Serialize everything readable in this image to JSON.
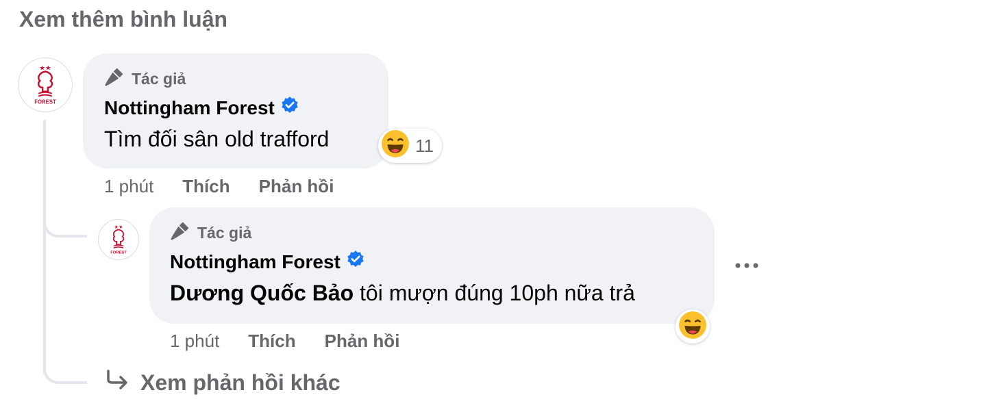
{
  "header": {
    "more_comments": "Xem thêm bình luận"
  },
  "comments": [
    {
      "author_badge": "Tác giả",
      "name": "Nottingham Forest",
      "verified": true,
      "text": "Tìm đối sân old trafford",
      "reaction": {
        "icon": "haha-emoji-icon",
        "count": "11"
      },
      "time": "1 phút",
      "like_label": "Thích",
      "reply_label": "Phản hồi"
    }
  ],
  "replies": [
    {
      "author_badge": "Tác giả",
      "name": "Nottingham Forest",
      "verified": true,
      "mention": "Dương Quốc Bảo",
      "text": " tôi mượn đúng 10ph nữa trả",
      "reaction": {
        "icon": "haha-emoji-icon"
      },
      "time": "1 phút",
      "like_label": "Thích",
      "reply_label": "Phản hồi"
    }
  ],
  "footer": {
    "view_more_replies": "Xem phản hồi khác"
  },
  "colors": {
    "bubble": "#f0f2f5",
    "secondary_text": "#65676b",
    "verified": "#1877f2",
    "crest_red": "#c8102e",
    "haha_yellow": "#fbc02d"
  }
}
